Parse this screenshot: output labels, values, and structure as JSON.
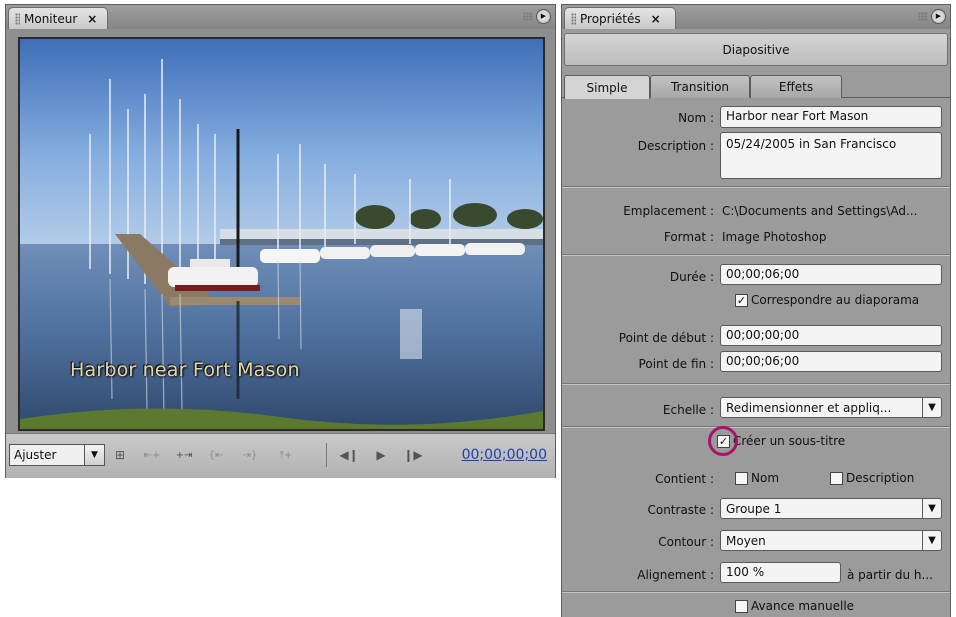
{
  "monitor": {
    "tab_label": "Moniteur",
    "close_glyph": "×",
    "caption": "Harbor near Fort Mason",
    "zoom_label": "Ajuster",
    "timecode": "00;00;00;00",
    "toolbar_icons": [
      "safe-margins-icon",
      "set-in-point-icon",
      "set-out-point-icon",
      "go-to-in-icon",
      "go-to-out-icon",
      "add-marker-icon",
      "step-back-icon",
      "play-icon",
      "step-forward-icon"
    ]
  },
  "properties": {
    "tab_label": "Propriétés",
    "close_glyph": "×",
    "title": "Diapositive",
    "tabs": [
      {
        "label": "Simple",
        "active": true
      },
      {
        "label": "Transition",
        "active": false
      },
      {
        "label": "Effets",
        "active": false
      }
    ],
    "name_label": "Nom :",
    "name_value": "Harbor near Fort Mason",
    "description_label": "Description :",
    "description_value": "05/24/2005 in San Francisco",
    "location_label": "Emplacement :",
    "location_value": "C:\\Documents and Settings\\Ad...",
    "format_label": "Format :",
    "format_value": "Image Photoshop",
    "duration_label": "Durée :",
    "duration_value": "00;00;06;00",
    "match_slideshow_label": "Correspondre au diaporama",
    "match_slideshow_checked": true,
    "in_point_label": "Point de début :",
    "in_point_value": "00;00;00;00",
    "out_point_label": "Point de fin :",
    "out_point_value": "00;00;06;00",
    "scale_label": "Echelle :",
    "scale_value": "Redimensionner et appliq...",
    "create_caption_label": "Créer un sous-titre",
    "create_caption_checked": true,
    "contains_label": "Contient :",
    "contains_name_label": "Nom",
    "contains_description_label": "Description",
    "contrast_label": "Contraste :",
    "contrast_value": "Groupe 1",
    "outline_label": "Contour :",
    "outline_value": "Moyen",
    "alignment_label": "Alignement :",
    "alignment_value": "100 %",
    "alignment_suffix": "à partir du h...",
    "manual_advance_label": "Avance manuelle"
  },
  "colors": {
    "timecode": "#1f3fb0",
    "highlight_ring": "#a8146a",
    "caption_text": "#e9d8a6"
  }
}
